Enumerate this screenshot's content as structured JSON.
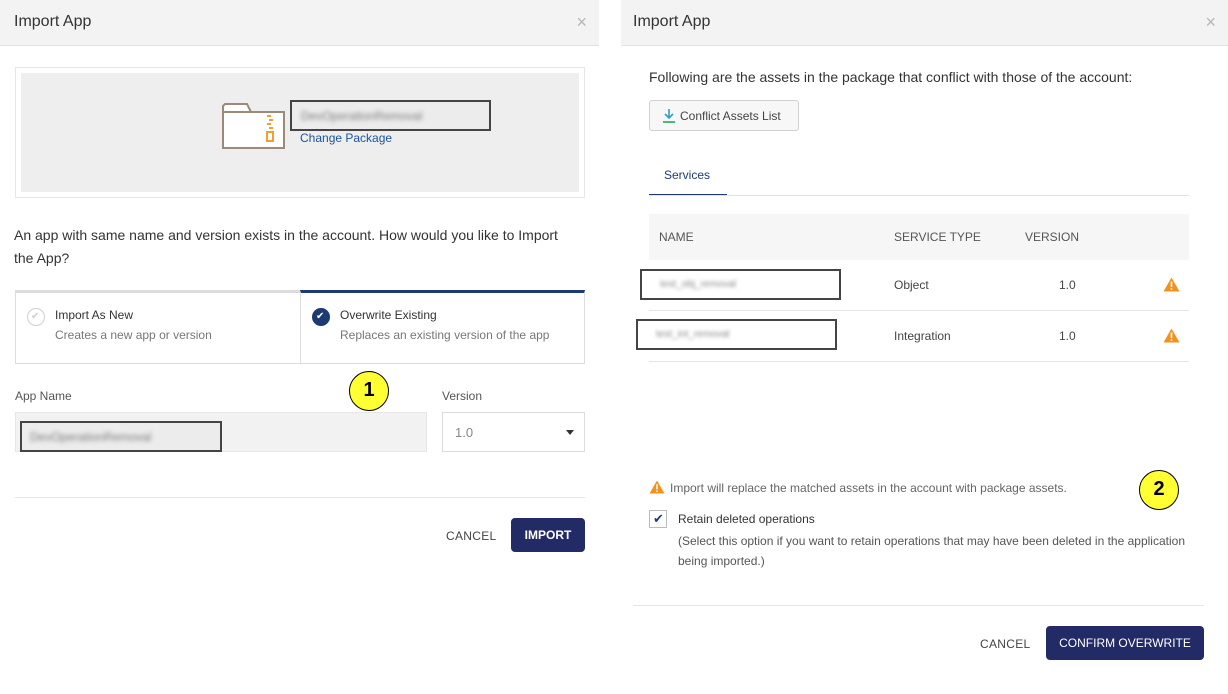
{
  "left": {
    "title": "Import App",
    "close_icon": "×",
    "package": {
      "name": "DevOperationRemoval",
      "change_label": "Change Package",
      "icon": "zip-folder-icon"
    },
    "question": "An app with same name and version exists in the account. How would you like to Import the App?",
    "options": [
      {
        "title": "Import As New",
        "description": "Creates a new app or version",
        "selected": false
      },
      {
        "title": "Overwrite Existing",
        "description": "Replaces an existing version of the app",
        "selected": true
      }
    ],
    "app_name_label": "App Name",
    "app_name_value": "DevOperationRemoval",
    "version_label": "Version",
    "version_value": "1.0",
    "cancel_label": "CANCEL",
    "import_label": "IMPORT",
    "callout": "1"
  },
  "right": {
    "title": "Import App",
    "close_icon": "×",
    "intro": "Following are the assets in the package that conflict with those of the account:",
    "conflict_button": "Conflict Assets List",
    "tab_label": "Services",
    "columns": [
      "NAME",
      "SERVICE TYPE",
      "VERSION"
    ],
    "rows": [
      {
        "name": "test_obj_removal",
        "type": "Object",
        "version": "1.0",
        "warning": true
      },
      {
        "name": "test_int_removal",
        "type": "Integration",
        "version": "1.0",
        "warning": true
      }
    ],
    "warning_note": "Import will replace the matched assets in the account with package assets.",
    "retain_label": "Retain deleted operations",
    "retain_checked": true,
    "retain_help": "(Select this option if you want to retain operations that may have been deleted in the application being imported.)",
    "cancel_label": "CANCEL",
    "confirm_label": "CONFIRM OVERWRITE",
    "callout": "2"
  },
  "colors": {
    "primary": "#222b66",
    "accent": "#1d3a72",
    "link": "#1a56a0",
    "warning": "#f0921e",
    "callout": "#ffff33"
  }
}
